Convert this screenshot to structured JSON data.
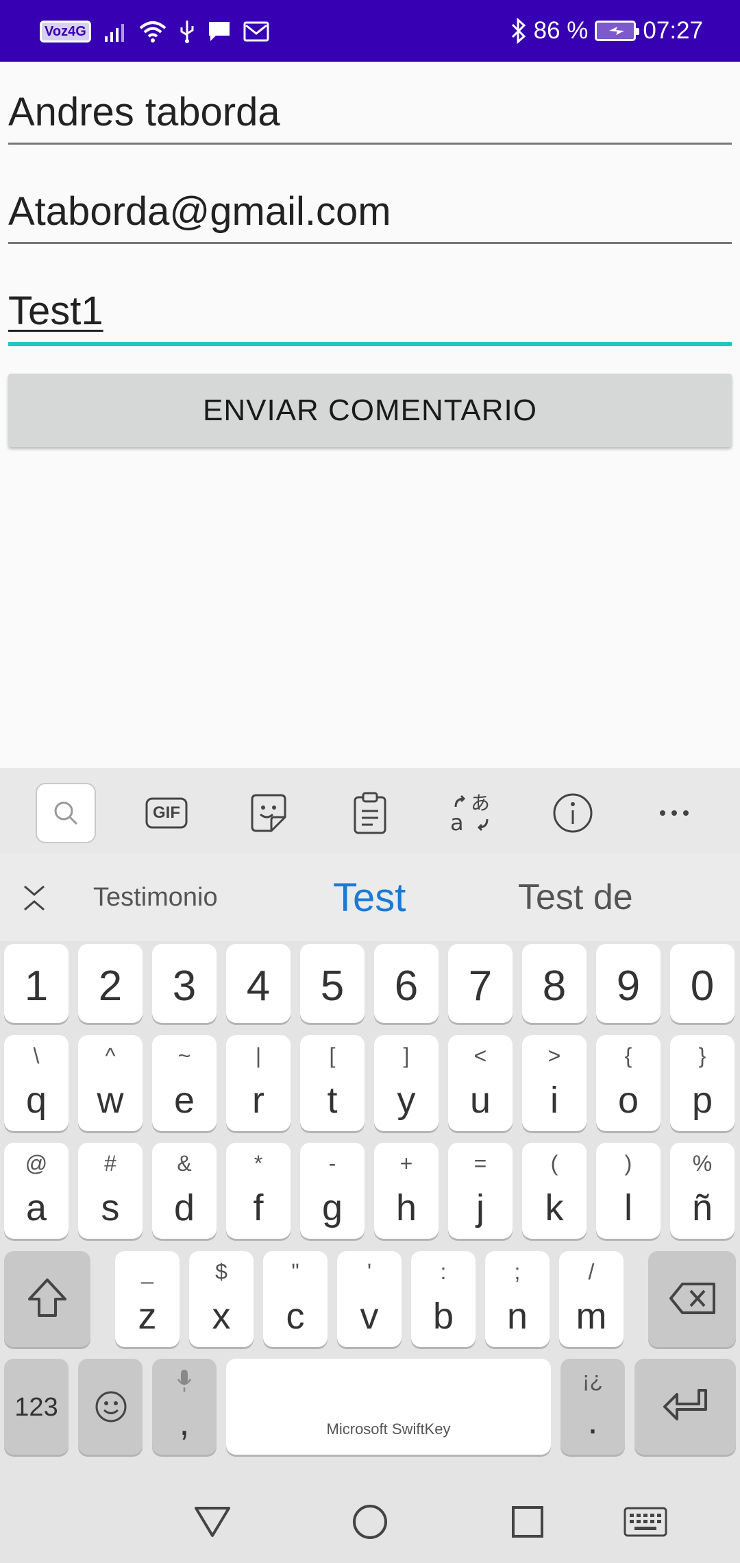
{
  "status_bar": {
    "volte": "Voz4G",
    "battery_percent": "86 %",
    "time": "07:27",
    "icons": [
      "signal-icon",
      "wifi-icon",
      "usb-icon",
      "message-icon",
      "mail-icon",
      "bluetooth-icon",
      "battery-charging-icon"
    ]
  },
  "form": {
    "name_value": "Andres taborda",
    "email_value": "Ataborda@gmail.com",
    "comment_value": "Test1",
    "submit_label": "ENVIAR COMENTARIO"
  },
  "keyboard": {
    "toolbar_icons": [
      "search-icon",
      "gif-icon",
      "sticker-icon",
      "clipboard-icon",
      "translate-icon",
      "info-icon",
      "more-icon"
    ],
    "gif_label": "GIF",
    "suggestions": [
      "Testimonio",
      "Test",
      "Test de"
    ],
    "number_row": [
      "1",
      "2",
      "3",
      "4",
      "5",
      "6",
      "7",
      "8",
      "9",
      "0"
    ],
    "row1": [
      {
        "main": "q",
        "sec": "\\"
      },
      {
        "main": "w",
        "sec": "^"
      },
      {
        "main": "e",
        "sec": "~"
      },
      {
        "main": "r",
        "sec": "|"
      },
      {
        "main": "t",
        "sec": "["
      },
      {
        "main": "y",
        "sec": "]"
      },
      {
        "main": "u",
        "sec": "<"
      },
      {
        "main": "i",
        "sec": ">"
      },
      {
        "main": "o",
        "sec": "{"
      },
      {
        "main": "p",
        "sec": "}"
      }
    ],
    "row2": [
      {
        "main": "a",
        "sec": "@"
      },
      {
        "main": "s",
        "sec": "#"
      },
      {
        "main": "d",
        "sec": "&"
      },
      {
        "main": "f",
        "sec": "*"
      },
      {
        "main": "g",
        "sec": "-"
      },
      {
        "main": "h",
        "sec": "+"
      },
      {
        "main": "j",
        "sec": "="
      },
      {
        "main": "k",
        "sec": "("
      },
      {
        "main": "l",
        "sec": ")"
      },
      {
        "main": "ñ",
        "sec": "%"
      }
    ],
    "row3": [
      {
        "main": "z",
        "sec": "_"
      },
      {
        "main": "x",
        "sec": "$"
      },
      {
        "main": "c",
        "sec": "\""
      },
      {
        "main": "v",
        "sec": "'"
      },
      {
        "main": "b",
        "sec": ":"
      },
      {
        "main": "n",
        "sec": ";"
      },
      {
        "main": "m",
        "sec": "/"
      }
    ],
    "numbers_key": "123",
    "comma_key": ",",
    "period_key": ".",
    "period_sec": "¡¿",
    "space_label": "Microsoft SwiftKey"
  },
  "nav_icons": [
    "back-icon",
    "home-icon",
    "recents-icon",
    "keyboard-switch-icon"
  ]
}
